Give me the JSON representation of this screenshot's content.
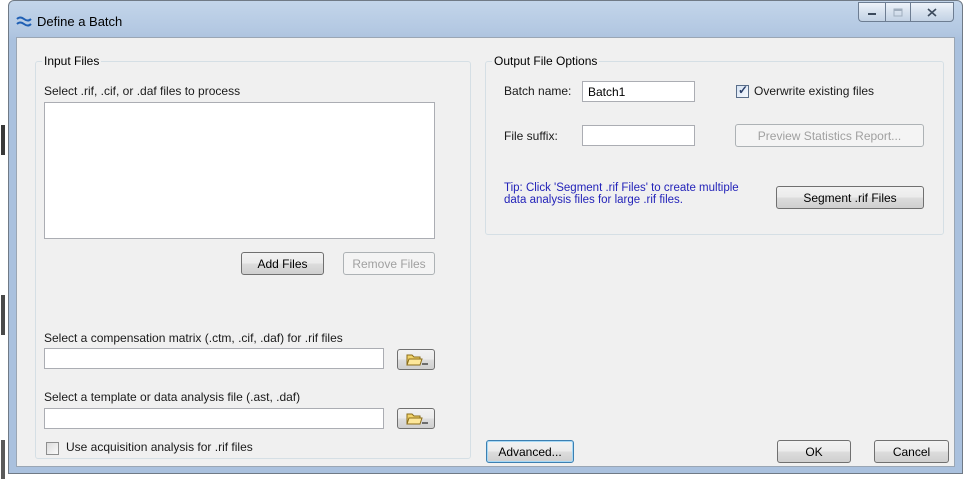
{
  "window": {
    "title": "Define a Batch",
    "icon": "wave-app-icon",
    "controls": {
      "minimize": "minimize-icon",
      "maximize": "maximize-icon",
      "close": "close-icon"
    }
  },
  "input_files": {
    "group_title": "Input Files",
    "select_label": "Select .rif, .cif, or .daf files to process",
    "files": [],
    "add_button": "Add Files",
    "remove_button": "Remove Files",
    "comp_label": "Select a compensation matrix (.ctm, .cif, .daf) for .rif files",
    "comp_value": "",
    "template_label": "Select a template or data analysis file (.ast, .daf)",
    "template_value": "",
    "acquisition_label": "Use acquisition analysis for .rif files",
    "acquisition_checked": false
  },
  "output_options": {
    "group_title": "Output File Options",
    "batch_name_label": "Batch name:",
    "batch_name_value": "Batch1",
    "overwrite_label": "Overwrite existing files",
    "overwrite_checked": true,
    "suffix_label": "File suffix:",
    "suffix_value": "",
    "preview_button": "Preview Statistics Report...",
    "tip_line1": "Tip:  Click 'Segment .rif Files' to create multiple",
    "tip_line2": "data analysis files for large .rif files.",
    "segment_button": "Segment .rif Files"
  },
  "footer": {
    "advanced_button": "Advanced...",
    "ok_button": "OK",
    "cancel_button": "Cancel"
  }
}
